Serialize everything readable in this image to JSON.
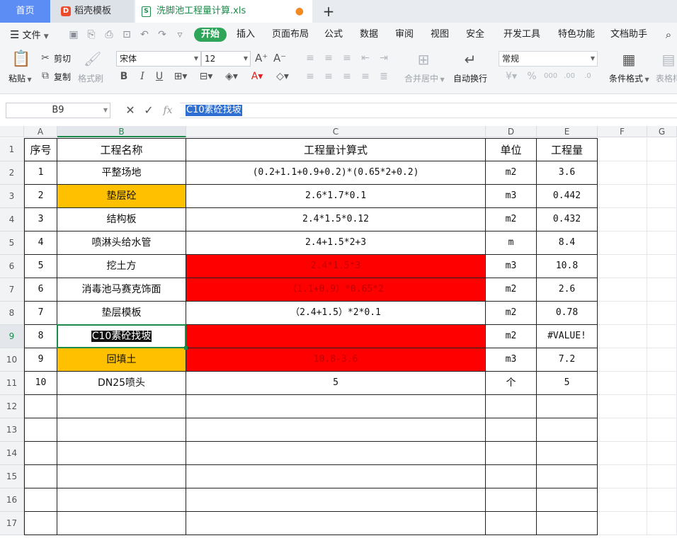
{
  "tabs": {
    "home": "首页",
    "template": "稻壳模板",
    "file": "洗脚池工程量计算.xls",
    "new_tab": "+"
  },
  "menu": {
    "file": "文件",
    "items": [
      "开始",
      "插入",
      "页面布局",
      "公式",
      "数据",
      "审阅",
      "视图",
      "安全",
      "开发工具",
      "特色功能",
      "文档助手"
    ]
  },
  "ribbon": {
    "paste": "粘贴",
    "cut": "剪切",
    "copy": "复制",
    "format_painter": "格式刷",
    "font_name": "宋体",
    "font_size": "12",
    "merge_center": "合并居中",
    "wrap_text": "自动换行",
    "number_format": "常规",
    "conditional_format": "条件格式",
    "table_style": "表格样"
  },
  "formula_bar": {
    "cell_ref": "B9",
    "fx": "fx",
    "content": "C10素砼找坡"
  },
  "columns": [
    "A",
    "B",
    "C",
    "D",
    "E",
    "F",
    "G"
  ],
  "rows": [
    "1",
    "2",
    "3",
    "4",
    "5",
    "6",
    "7",
    "8",
    "9",
    "10",
    "11",
    "12",
    "13",
    "14",
    "15",
    "16",
    "17"
  ],
  "table": [
    [
      "序号",
      "工程名称",
      "工程量计算式",
      "单位",
      "工程量"
    ],
    [
      "1",
      "平整场地",
      "(0.2+1.1+0.9+0.2)*(0.65*2+0.2)",
      "m2",
      "3.6"
    ],
    [
      "2",
      "垫层砼",
      "2.6*1.7*0.1",
      "m3",
      "0.442"
    ],
    [
      "3",
      "结构板",
      "2.4*1.5*0.12",
      "m2",
      "0.432"
    ],
    [
      "4",
      "喷淋头给水管",
      "2.4+1.5*2+3",
      "m",
      "8.4"
    ],
    [
      "5",
      "挖土方",
      "2.4*1.5*3",
      "m3",
      "10.8"
    ],
    [
      "6",
      "消毒池马赛克饰面",
      "（1.1+0.9）*0.65*2",
      "m2",
      "2.6"
    ],
    [
      "7",
      "垫层模板",
      "（2.4+1.5）*2*0.1",
      "m2",
      "0.78"
    ],
    [
      "8",
      "C10素砼找坡",
      "",
      "m2",
      "#VALUE!"
    ],
    [
      "9",
      "回填土",
      "10.8-3.6",
      "m3",
      "7.2"
    ],
    [
      "10",
      "DN25喷头",
      "5",
      "个",
      "5"
    ]
  ],
  "colors": {
    "accent": "#1d8a4b",
    "home_tab": "#5b8df5",
    "start_pill": "#2fa55a",
    "fill_red": "#ff0000",
    "fill_orange": "#ffc000",
    "formula_highlight": "#2f6fd1"
  }
}
